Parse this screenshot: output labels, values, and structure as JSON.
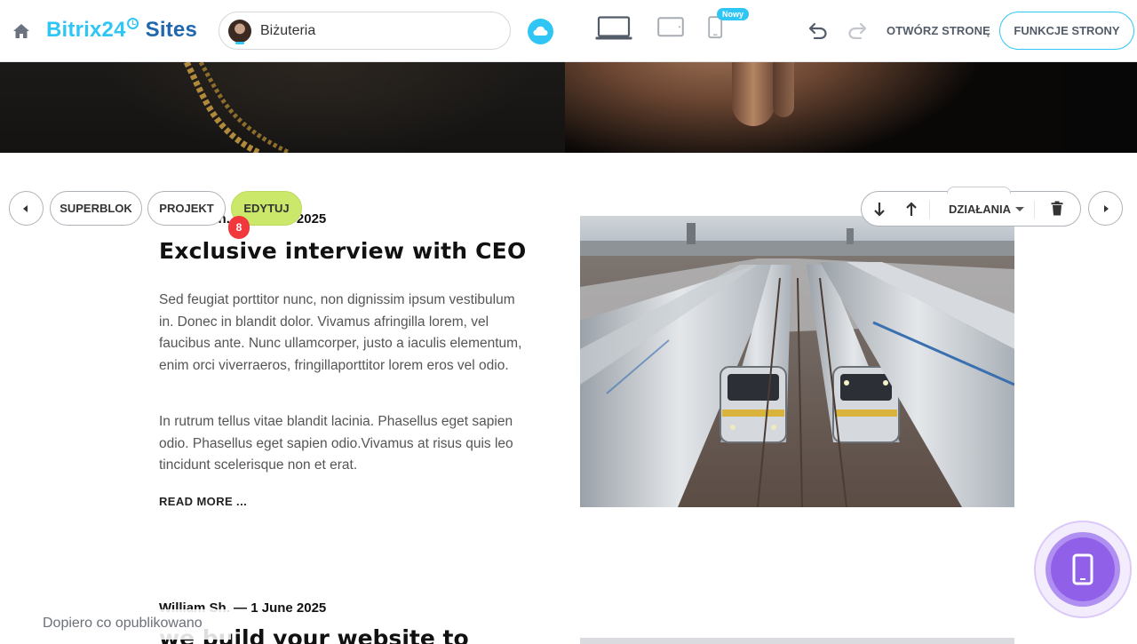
{
  "app": {
    "brand_part1": "Bitrix24",
    "brand_part2": "Sites",
    "site_name": "Biżuteria",
    "new_badge": "Nowy",
    "open_page": "OTWÓRZ STRONĘ",
    "page_features": "FUNKCJE STRONY",
    "accent_color": "#2fc6f6",
    "icons": [
      "home-icon",
      "cloud-icon",
      "desktop-icon",
      "tablet-icon",
      "mobile-icon",
      "undo-icon",
      "redo-icon"
    ]
  },
  "block_toolbar": {
    "superblock": "SUPERBLOK",
    "design": "PROJEKT",
    "edit": "EDYTUJ",
    "edit_badge": "8",
    "actions": "DZIAŁANIA",
    "edit_color": "#cbe86b"
  },
  "article": {
    "meta": "William Sh.  —  1 June 2025",
    "title": "Exclusive interview with CEO",
    "paragraph1": "Sed feugiat porttitor nunc, non dignissim ipsum vestibulum in. Donec in blandit dolor. Vivamus afringilla lorem, vel faucibus ante. Nunc ullamcorper, justo a iaculis elementum, enim orci viverraeros, fringillaporttitor lorem eros vel odio.",
    "paragraph2": "In rutrum tellus vitae blandit lacinia. Phasellus eget sapien odio. Phasellus eget sapien odio.Vivamus at risus quis leo tincidunt scelerisque non et erat.",
    "read_more": "READ MORE ..."
  },
  "article2": {
    "meta": "William Sh.  —  1 June 2025",
    "title": "we build your website to"
  },
  "status": {
    "published": "Dopiero co opublikowano"
  },
  "fab": {
    "icon": "mobile-preview-icon",
    "color": "#9160e8"
  }
}
